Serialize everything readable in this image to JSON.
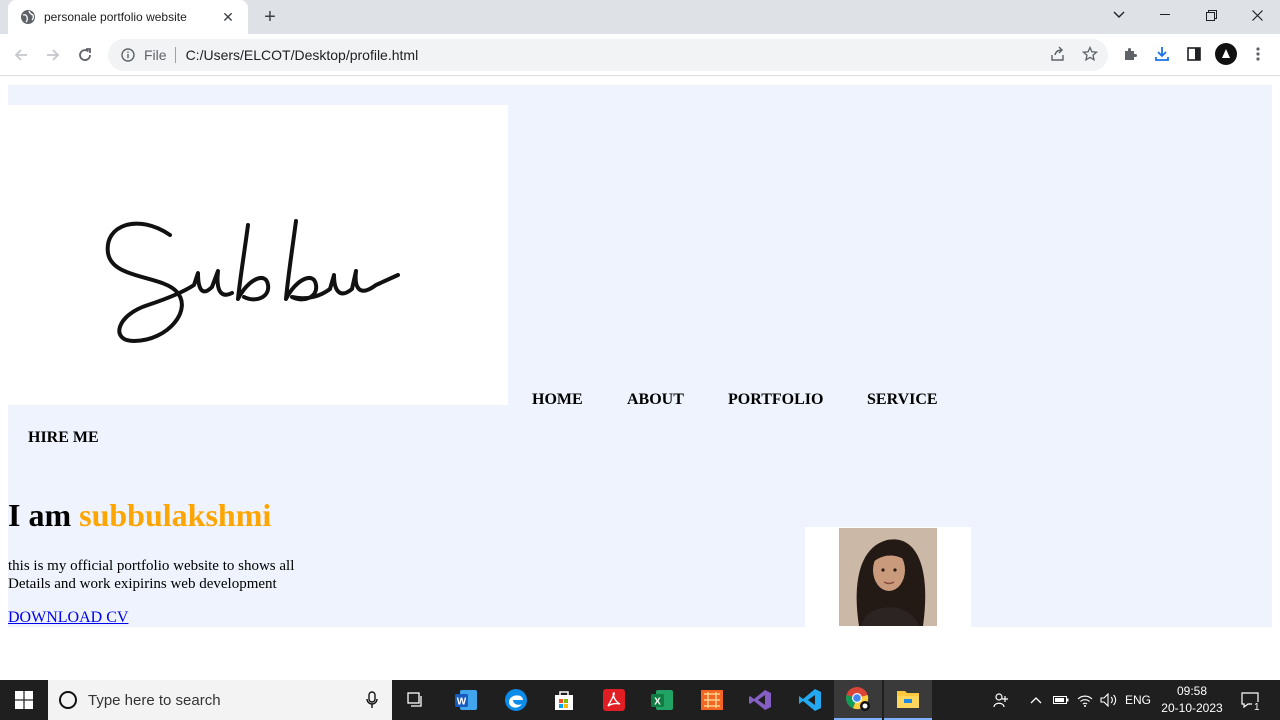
{
  "browser": {
    "tab_title": "personale portfolio website",
    "url_scheme": "File",
    "url": "C:/Users/ELCOT/Desktop/profile.html"
  },
  "site": {
    "logo_text": "Subbu",
    "nav": [
      "HOME",
      "ABOUT",
      "PORTFOLIO",
      "SERVICE",
      "HIRE ME"
    ],
    "hero_prefix": "I am",
    "hero_name": "subbulakshmi",
    "hero_line1": "this is my official portfolio website to shows all",
    "hero_line2": "Details and work exipirins web development",
    "download_cv": "DOWNLOAD CV",
    "accent_color": "#ffa500",
    "background_color": "#eef3fd"
  },
  "taskbar": {
    "search_placeholder": "Type here to search",
    "language": "ENG",
    "time": "09:58",
    "date": "20-10-2023",
    "notification_count": "1"
  }
}
